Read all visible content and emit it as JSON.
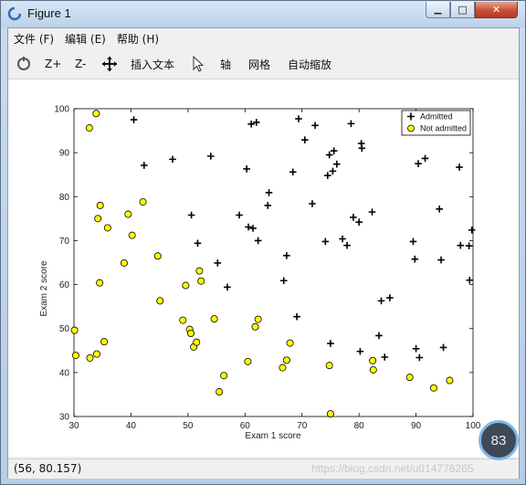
{
  "window": {
    "title": "Figure 1",
    "min_glyph": "▁",
    "max_glyph": "□",
    "close_glyph": "✕",
    "icon": "matlab-figure-icon"
  },
  "menubar": {
    "items": [
      {
        "label": "文件 (F)"
      },
      {
        "label": "编辑 (E)"
      },
      {
        "label": "帮助 (H)"
      }
    ]
  },
  "toolbar": {
    "zoom_in_label": "Z+",
    "zoom_out_label": "Z-",
    "insert_text_label": "插入文本",
    "axis_label": "轴",
    "grid_label": "网格",
    "autoscale_label": "自动缩放"
  },
  "status": {
    "coords": "(56, 80.157)",
    "watermark": "https://blog.csdn.net/u014776265",
    "badge": "83"
  },
  "colors": {
    "admitted_marker": "#000000",
    "not_admitted_fill": "#ffff00",
    "not_admitted_edge": "#000000"
  },
  "chart_data": {
    "type": "scatter",
    "xlabel": "Exam 1 score",
    "ylabel": "Exam 2 score",
    "xlim": [
      30,
      100
    ],
    "ylim": [
      30,
      100
    ],
    "xticks": [
      "30",
      "40",
      "50",
      "60",
      "70",
      "80",
      "90",
      "100"
    ],
    "yticks": [
      "30",
      "40",
      "50",
      "60",
      "70",
      "80",
      "90",
      "100"
    ],
    "legend_position": "top-right",
    "series": [
      {
        "name": "Admitted",
        "marker": "plus",
        "points": [
          [
            40.5,
            97.5
          ],
          [
            42.3,
            87.1
          ],
          [
            47.3,
            88.5
          ],
          [
            50.6,
            75.8
          ],
          [
            51.7,
            69.4
          ],
          [
            54.0,
            89.2
          ],
          [
            55.2,
            64.9
          ],
          [
            56.9,
            59.4
          ],
          [
            59.0,
            75.8
          ],
          [
            60.3,
            86.3
          ],
          [
            60.6,
            73.1
          ],
          [
            61.1,
            96.5
          ],
          [
            61.4,
            72.8
          ],
          [
            62.0,
            96.9
          ],
          [
            62.3,
            70.0
          ],
          [
            64.0,
            78.0
          ],
          [
            64.2,
            80.9
          ],
          [
            66.8,
            60.9
          ],
          [
            67.3,
            66.6
          ],
          [
            68.4,
            85.6
          ],
          [
            69.1,
            52.7
          ],
          [
            69.4,
            97.7
          ],
          [
            70.5,
            92.9
          ],
          [
            71.8,
            78.4
          ],
          [
            72.3,
            96.2
          ],
          [
            74.1,
            69.8
          ],
          [
            74.5,
            84.8
          ],
          [
            74.8,
            89.5
          ],
          [
            75.0,
            46.6
          ],
          [
            75.4,
            85.8
          ],
          [
            75.6,
            90.4
          ],
          [
            76.1,
            87.4
          ],
          [
            77.1,
            70.4
          ],
          [
            77.9,
            68.9
          ],
          [
            78.6,
            96.6
          ],
          [
            79.0,
            75.3
          ],
          [
            80.0,
            74.2
          ],
          [
            80.2,
            44.8
          ],
          [
            80.4,
            92.1
          ],
          [
            80.5,
            91.0
          ],
          [
            82.3,
            76.5
          ],
          [
            83.5,
            48.4
          ],
          [
            83.9,
            56.3
          ],
          [
            84.5,
            43.5
          ],
          [
            85.4,
            57.0
          ],
          [
            89.5,
            69.8
          ],
          [
            89.8,
            65.8
          ],
          [
            90.0,
            45.4
          ],
          [
            90.4,
            87.5
          ],
          [
            90.6,
            43.4
          ],
          [
            91.6,
            88.7
          ],
          [
            94.1,
            77.2
          ],
          [
            94.4,
            65.6
          ],
          [
            94.8,
            45.7
          ],
          [
            97.6,
            86.7
          ],
          [
            97.8,
            68.9
          ],
          [
            99.3,
            68.8
          ],
          [
            99.4,
            61.0
          ],
          [
            99.8,
            72.4
          ]
        ]
      },
      {
        "name": "Not admitted",
        "marker": "circle",
        "points": [
          [
            30.3,
            43.9
          ],
          [
            30.1,
            49.6
          ],
          [
            32.7,
            95.6
          ],
          [
            32.8,
            43.3
          ],
          [
            33.9,
            98.9
          ],
          [
            34.0,
            44.2
          ],
          [
            34.2,
            75.0
          ],
          [
            34.5,
            60.4
          ],
          [
            34.6,
            78.0
          ],
          [
            35.3,
            47.0
          ],
          [
            35.9,
            72.9
          ],
          [
            38.8,
            64.9
          ],
          [
            39.5,
            76.0
          ],
          [
            40.2,
            71.2
          ],
          [
            42.1,
            78.8
          ],
          [
            44.7,
            66.5
          ],
          [
            45.1,
            56.3
          ],
          [
            49.1,
            51.9
          ],
          [
            49.6,
            59.8
          ],
          [
            50.3,
            49.8
          ],
          [
            50.5,
            48.9
          ],
          [
            51.0,
            45.8
          ],
          [
            51.5,
            46.9
          ],
          [
            52.0,
            63.1
          ],
          [
            52.3,
            60.8
          ],
          [
            54.6,
            52.2
          ],
          [
            55.5,
            35.6
          ],
          [
            56.3,
            39.3
          ],
          [
            60.5,
            42.5
          ],
          [
            61.8,
            50.4
          ],
          [
            62.3,
            52.1
          ],
          [
            66.6,
            41.1
          ],
          [
            67.3,
            42.8
          ],
          [
            67.9,
            46.7
          ],
          [
            74.8,
            41.6
          ],
          [
            75.0,
            30.6
          ],
          [
            82.4,
            42.7
          ],
          [
            82.5,
            40.6
          ],
          [
            88.9,
            38.9
          ],
          [
            93.1,
            36.5
          ],
          [
            95.9,
            38.2
          ]
        ]
      }
    ]
  }
}
